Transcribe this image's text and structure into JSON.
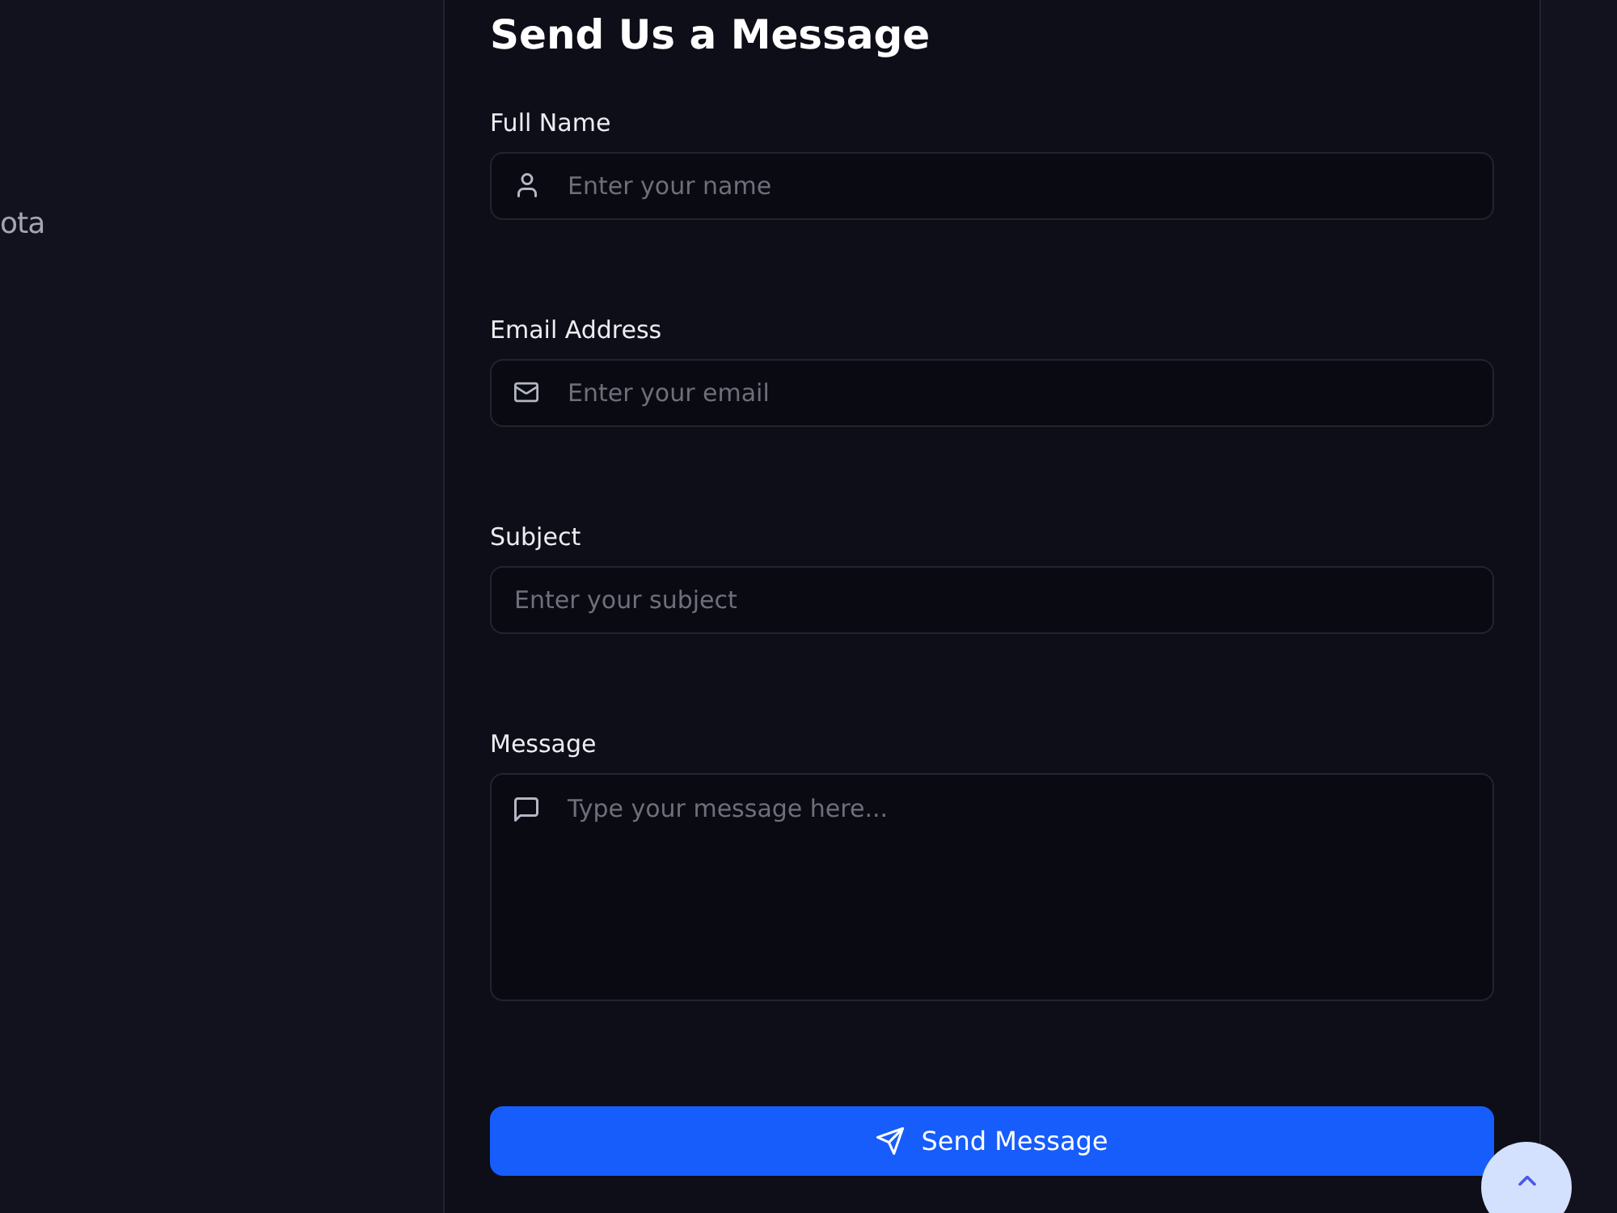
{
  "sidebar": {
    "text_fragment": "ota"
  },
  "contact_form": {
    "title": "Send Us a Message",
    "fields": [
      {
        "kind": "name",
        "label": "Full Name",
        "placeholder": "Enter your name"
      },
      {
        "kind": "email",
        "label": "Email Address",
        "placeholder": "Enter your email"
      },
      {
        "kind": "subject",
        "label": "Subject",
        "placeholder": "Enter your subject"
      },
      {
        "kind": "message",
        "label": "Message",
        "placeholder": "Type your message here..."
      }
    ],
    "submit_button": {
      "label": "Send Message"
    }
  }
}
